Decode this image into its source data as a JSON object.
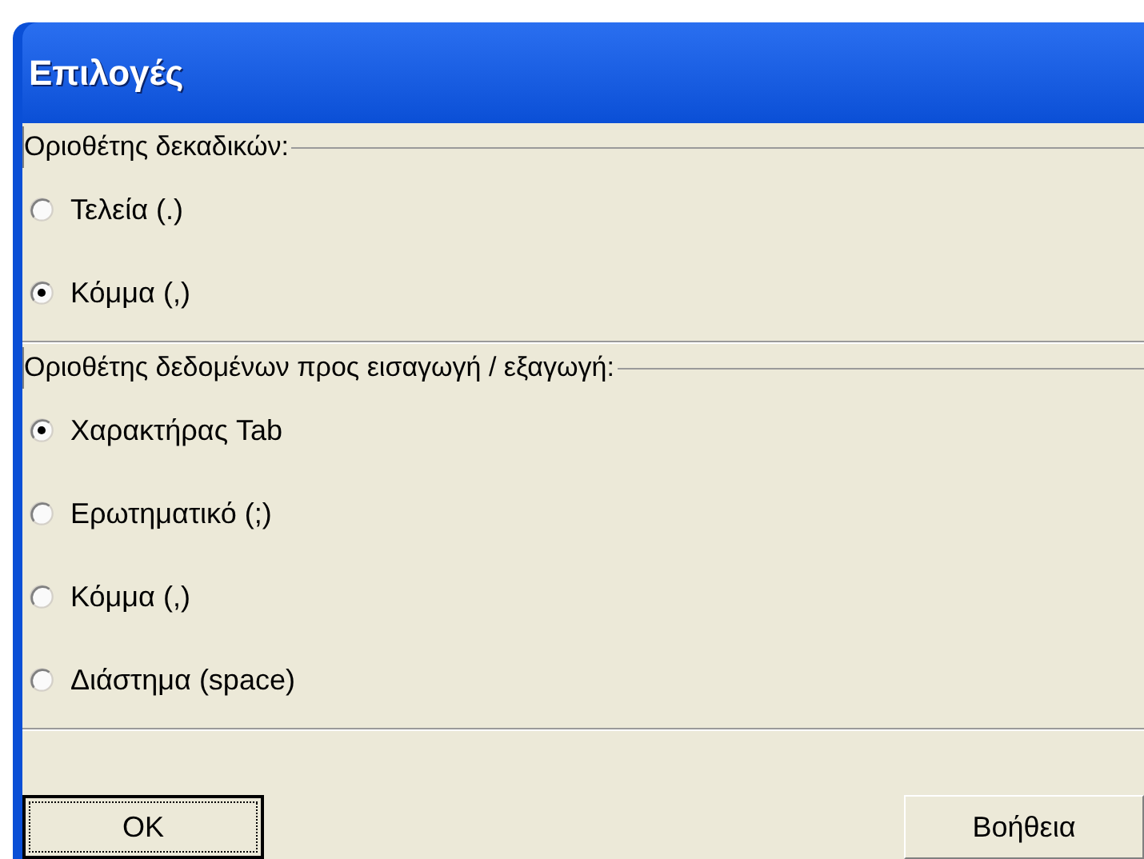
{
  "window": {
    "title": "Επιλογές"
  },
  "groups": [
    {
      "label": "Οριοθέτης δεκαδικών:",
      "options": [
        {
          "label": "Τελεία (.)",
          "selected": false
        },
        {
          "label": "Κόμμα (,)",
          "selected": true
        }
      ]
    },
    {
      "label": "Οριοθέτης δεδομένων προς εισαγωγή / εξαγωγή:",
      "options": [
        {
          "label": "Χαρακτήρας Tab",
          "selected": true
        },
        {
          "label": "Ερωτηματικό (;)",
          "selected": false
        },
        {
          "label": "Κόμμα (,)",
          "selected": false
        },
        {
          "label": "Διάστημα (space)",
          "selected": false
        }
      ]
    }
  ],
  "buttons": [
    {
      "label": "OK",
      "focused": true
    },
    {
      "label": "Βοήθεια",
      "focused": false
    }
  ]
}
